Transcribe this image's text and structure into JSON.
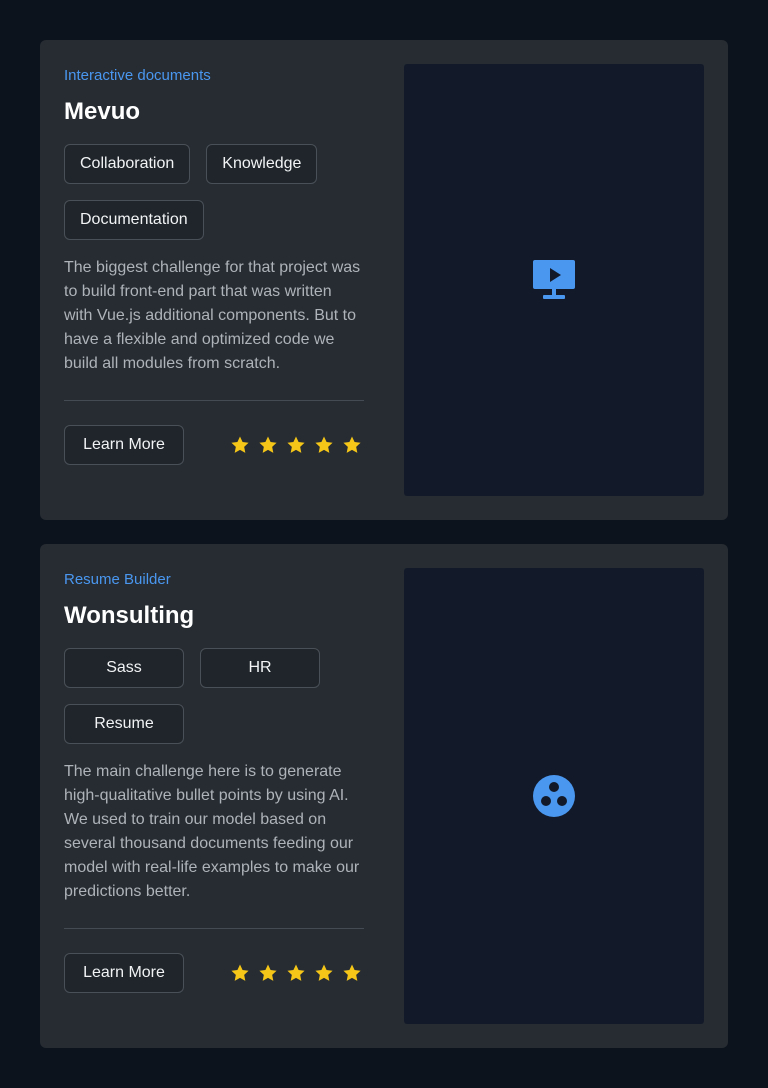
{
  "colors": {
    "background": "#0d131c",
    "card": "#262c32",
    "accent": "#4a97f0",
    "star": "#f5c518",
    "media_bg": "#121a2a"
  },
  "projects": [
    {
      "category": "Interactive documents",
      "title": "Mevuo",
      "tags": [
        "Collaboration",
        "Knowledge",
        "Documentation"
      ],
      "description": "The biggest challenge for that project was to build front-end part that was written with Vue.js additional components. But to have a flexible and optimized code we build all modules from scratch.",
      "button_label": "Learn More",
      "rating": 5,
      "media_icon": "presentation-play-icon"
    },
    {
      "category": "Resume Builder",
      "title": "Wonsulting",
      "tags": [
        "Sass",
        "HR",
        "Resume"
      ],
      "description": "The main challenge here is to generate high-qualitative bullet points by using AI. We used to train our model based on several thousand documents feeding our model with real-life examples to make our predictions better.",
      "button_label": "Learn More",
      "rating": 5,
      "media_icon": "film-reel-icon"
    }
  ]
}
